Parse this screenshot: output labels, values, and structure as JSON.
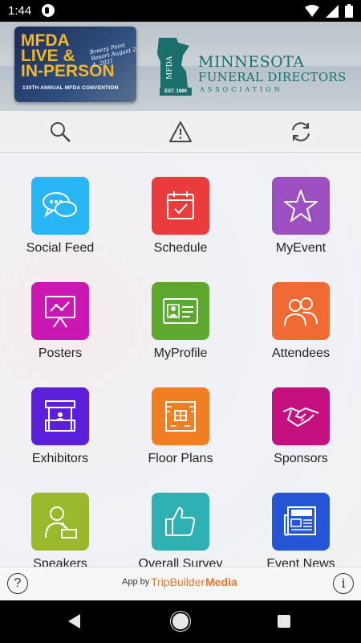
{
  "status_bar": {
    "time": "1:44"
  },
  "banner": {
    "convention_logo": {
      "line1": "MFDA",
      "line2": "LIVE &",
      "line3": "IN-PERSON",
      "subtitle": "130TH ANNUAL MFDA CONVENTION",
      "script": "Breezy Point Resort August 2-4, 2021"
    },
    "association_logo": {
      "abbrev": "MFDA",
      "est": "EST. 1890",
      "name_line1": "MINNESOTA",
      "name_line2": "FUNERAL DIRECTORS",
      "name_line3": "ASSOCIATION"
    }
  },
  "toolbar": {
    "buttons": [
      "search-icon",
      "alert-icon",
      "refresh-icon"
    ]
  },
  "tiles": [
    {
      "label": "Social Feed",
      "color": "#29b6f6",
      "icon": "chat-bubbles-icon"
    },
    {
      "label": "Schedule",
      "color": "#ea3c3c",
      "icon": "calendar-check-icon"
    },
    {
      "label": "MyEvent",
      "color": "#9c4fc0",
      "icon": "star-icon"
    },
    {
      "label": "Posters",
      "color": "#cc18b3",
      "icon": "presentation-board-icon"
    },
    {
      "label": "MyProfile",
      "color": "#5da92f",
      "icon": "id-card-icon"
    },
    {
      "label": "Attendees",
      "color": "#f06a33",
      "icon": "people-icon"
    },
    {
      "label": "Exhibitors",
      "color": "#5b1fd9",
      "icon": "booth-icon"
    },
    {
      "label": "Floor Plans",
      "color": "#f07f23",
      "icon": "floor-plan-icon"
    },
    {
      "label": "Sponsors",
      "color": "#c4117f",
      "icon": "handshake-icon"
    },
    {
      "label": "Speakers",
      "color": "#9ab82c",
      "icon": "speaker-podium-icon"
    },
    {
      "label": "Overall Survey",
      "color": "#2fb0b3",
      "icon": "thumbs-up-icon"
    },
    {
      "label": "Event News",
      "color": "#2556d6",
      "icon": "newspaper-icon"
    }
  ],
  "footer": {
    "help": "?",
    "info": "i",
    "credit_prefix": "App by",
    "brand_part1": "TripBuilder",
    "brand_part2": "Media"
  },
  "colors": {
    "teal": "#1b6e6c",
    "brand_orange": "#e8742a"
  }
}
